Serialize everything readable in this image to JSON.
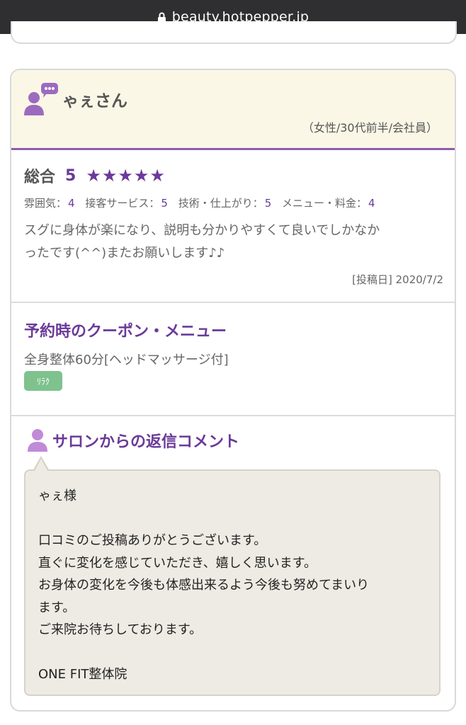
{
  "browser": {
    "url": "beauty.hotpepper.jp"
  },
  "review": {
    "reviewer_name": "ゃぇさん",
    "reviewer_profile": "（女性/30代前半/会社員）",
    "overall_label": "総合",
    "overall_score": "5",
    "stars": "★★★★★",
    "sub_ratings": [
      {
        "label": "雰囲気：",
        "value": "4"
      },
      {
        "label": "接客サービス：",
        "value": "5"
      },
      {
        "label": "技術・仕上がり：",
        "value": "5"
      },
      {
        "label": "メニュー・料金：",
        "value": "4"
      }
    ],
    "text_line1": "スグに身体が楽になり、説明も分かりやすくて良いでしかなか",
    "text_line2": "ったです(^^)またお願いします♪♪",
    "post_date": "[投稿日] 2020/7/2"
  },
  "coupon": {
    "title": "予約時のクーポン・メニュー",
    "menu": "全身整体60分[ヘッドマッサージ付]",
    "badge": "ﾘﾗｸ"
  },
  "reply": {
    "title": "サロンからの返信コメント",
    "lines": [
      "ゃぇ様",
      "",
      "口コミのご投稿ありがとうございます。",
      "直ぐに変化を感じていただき、嬉しく思います。",
      "お身体の変化を今後も体感出来るよう今後も努めてまいり",
      "ます。",
      "ご来院お待ちしております。",
      "",
      "ONE FIT整体院"
    ]
  },
  "colors": {
    "accent": "#6b3a99",
    "header_bg": "#fbf7e6",
    "badge": "#7fc28e",
    "bubble": "#edebe3"
  }
}
